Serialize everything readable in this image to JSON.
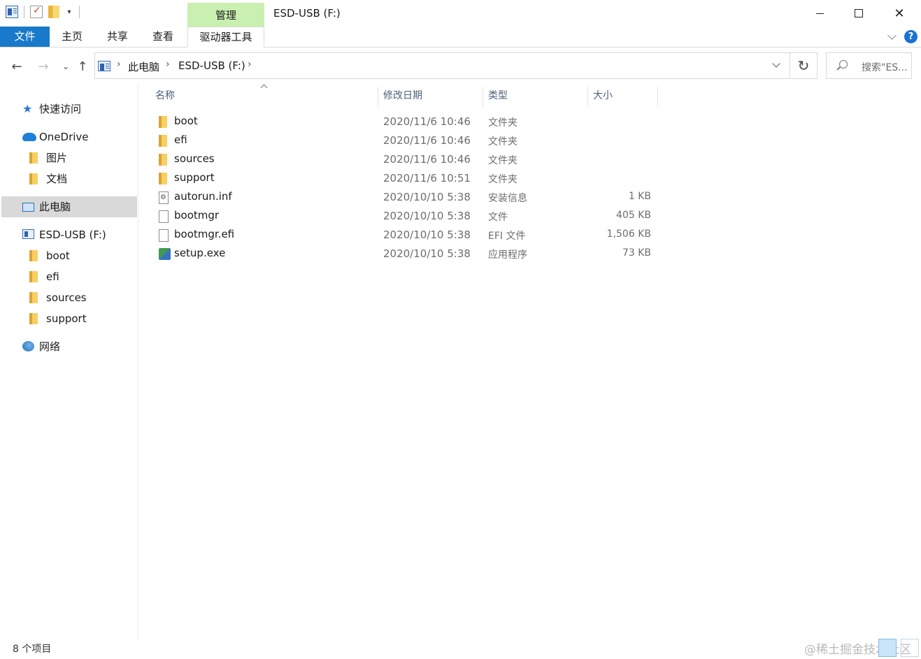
{
  "window": {
    "title": "ESD-USB (F:)",
    "contextual_tab_group": "管理",
    "controls": {
      "minimize": "—",
      "maximize": "☐",
      "close": "✕"
    }
  },
  "ribbon": {
    "tabs": [
      "文件",
      "主页",
      "共享",
      "查看",
      "驱动器工具"
    ],
    "help": "?"
  },
  "nav_buttons": {
    "back": "←",
    "forward": "→",
    "recent": "⌄",
    "up": "↑"
  },
  "address": {
    "crumbs": [
      "此电脑",
      "ESD-USB (F:)"
    ],
    "separator": "›",
    "refresh": "↻"
  },
  "search": {
    "placeholder": "搜索\"ES..."
  },
  "nav_pane": {
    "quick_access": "快速访问",
    "onedrive": "OneDrive",
    "onedrive_children": [
      "图片",
      "文档"
    ],
    "this_pc": "此电脑",
    "drive": "ESD-USB (F:)",
    "drive_children": [
      "boot",
      "efi",
      "sources",
      "support"
    ],
    "network": "网络"
  },
  "columns": {
    "name": "名称",
    "date": "修改日期",
    "type": "类型",
    "size": "大小"
  },
  "files": [
    {
      "name": "boot",
      "date": "2020/11/6 10:46",
      "type": "文件夹",
      "size": "",
      "icon": "folder-icon"
    },
    {
      "name": "efi",
      "date": "2020/11/6 10:46",
      "type": "文件夹",
      "size": "",
      "icon": "folder-icon"
    },
    {
      "name": "sources",
      "date": "2020/11/6 10:46",
      "type": "文件夹",
      "size": "",
      "icon": "folder-icon"
    },
    {
      "name": "support",
      "date": "2020/11/6 10:51",
      "type": "文件夹",
      "size": "",
      "icon": "folder-icon"
    },
    {
      "name": "autorun.inf",
      "date": "2020/10/10 5:38",
      "type": "安装信息",
      "size": "1 KB",
      "icon": "setup-info-icon"
    },
    {
      "name": "bootmgr",
      "date": "2020/10/10 5:38",
      "type": "文件",
      "size": "405 KB",
      "icon": "file-icon"
    },
    {
      "name": "bootmgr.efi",
      "date": "2020/10/10 5:38",
      "type": "EFI 文件",
      "size": "1,506 KB",
      "icon": "file-icon"
    },
    {
      "name": "setup.exe",
      "date": "2020/10/10 5:38",
      "type": "应用程序",
      "size": "73 KB",
      "icon": "setup-exe-icon"
    }
  ],
  "status": {
    "item_count": "8 个项目"
  },
  "watermark": "@稀土掘金技术社区"
}
